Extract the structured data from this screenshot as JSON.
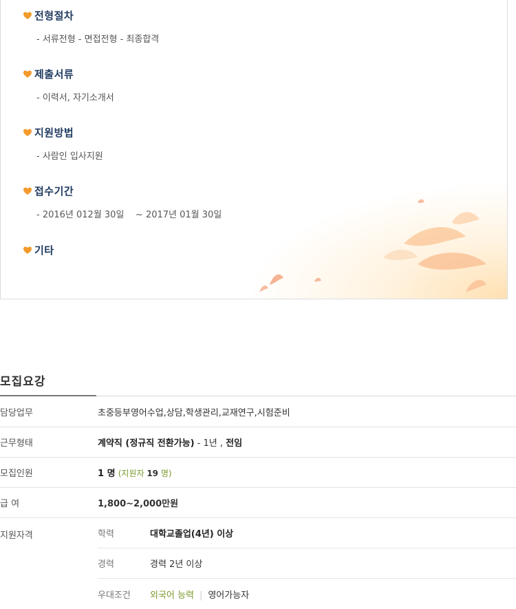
{
  "sections": [
    {
      "title": "전형절차",
      "desc": "- 서류전형 - 면접전형 - 최종합격"
    },
    {
      "title": "제출서류",
      "desc": "- 이력서, 자기소개서"
    },
    {
      "title": "지원방법",
      "desc": "- 사람인 입사지원"
    },
    {
      "title": "접수기간",
      "desc": "- 2016년 012월 30일    ~ 2017년 01월 30일"
    },
    {
      "title": "기타",
      "desc": ""
    }
  ],
  "recruit": {
    "title": "모집요강",
    "duty_label": "담당업무",
    "duty_value": "초중등부영어수업,상담,학생관리,교재연구,시험준비",
    "worktype_label": "근무형태",
    "worktype_bold": "계약직 (정규직 전환가능)",
    "worktype_rest": " - 1년 , ",
    "worktype_extra": "전임",
    "headcount_label": "모집인원",
    "headcount_value": "1 명",
    "headcount_applicants_prefix": "(지원자 ",
    "headcount_applicants_count": "19",
    "headcount_applicants_suffix": " 명)",
    "salary_label": "급 여",
    "salary_value": "1,800~2,000만원",
    "qual_label": "지원자격",
    "edu_label": "학력",
    "edu_value": "대학교졸업(4년) 이상",
    "exp_label": "경력",
    "exp_value": "경력 2년 이상",
    "pref_label": "우대조건",
    "pref_value1": "외국어 능력",
    "pref_sep": "|",
    "pref_value2": "영어가능자"
  }
}
